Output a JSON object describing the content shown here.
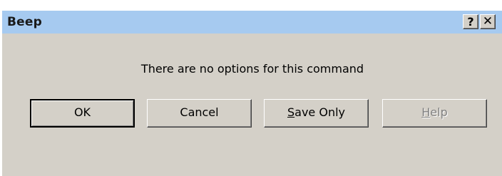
{
  "window": {
    "title": "Beep",
    "help_glyph": "?",
    "close_glyph": "✕"
  },
  "message": "There are no options for this command",
  "buttons": {
    "ok": {
      "label": "OK"
    },
    "cancel": {
      "label": "Cancel"
    },
    "save_only": {
      "mnemonic": "S",
      "rest": "ave Only"
    },
    "help": {
      "mnemonic": "H",
      "rest": "elp",
      "disabled": true
    }
  },
  "colors": {
    "titlebar": "#a6caf0",
    "face": "#d4d0c8",
    "disabled_text": "#808080"
  }
}
